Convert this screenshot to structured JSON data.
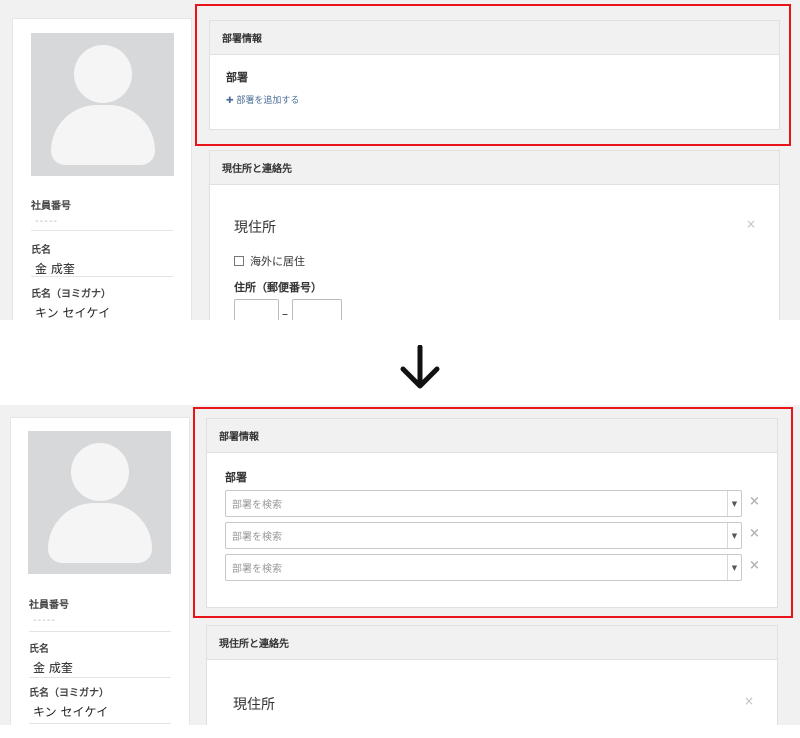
{
  "arrow_icon": "arrow-down-icon",
  "profile": {
    "employee_number_label": "社員番号",
    "employee_number_value": "-----",
    "name_label": "氏名",
    "name_value": "金 成奎",
    "kana_label": "氏名（ヨミガナ）",
    "kana_value": "キン セイケイ"
  },
  "dept_panel": {
    "header": "部署情報",
    "dept_label": "部署",
    "add_link": "✚ 部署を追加する",
    "select_placeholder": "部署を検索",
    "selects": [
      {
        "placeholder": "部署を検索"
      },
      {
        "placeholder": "部署を検索"
      },
      {
        "placeholder": "部署を検索"
      }
    ]
  },
  "address_panel": {
    "header": "現住所と連絡先",
    "section_title": "現住所",
    "overseas_label": "海外に居住",
    "postal_label": "住所（郵便番号）",
    "postal_dash": "–",
    "close_icon": "×"
  },
  "colors": {
    "highlight": "#e8141a",
    "link": "#4a6d96",
    "panel_header_bg": "#f1f1f1"
  }
}
